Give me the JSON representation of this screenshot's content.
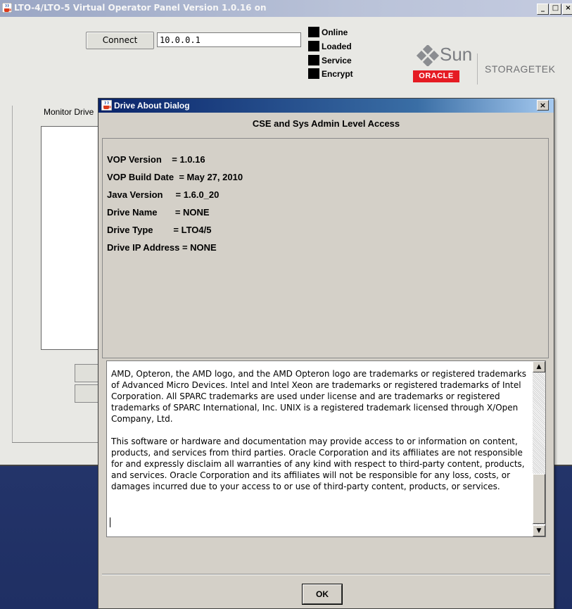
{
  "main_window": {
    "title": "LTO-4/LTO-5 Virtual Operator Panel Version 1.0.16 on",
    "controls": {
      "minimize": "_",
      "maximize": "□",
      "close": "×"
    },
    "connect_label": "Connect",
    "ip_value": "10.0.0.1",
    "status": [
      "Online",
      "Loaded",
      "Service",
      "Encrypt"
    ],
    "monitor_label": "Monitor Drive",
    "logo": {
      "sun": "Sun",
      "oracle": "ORACLE",
      "storagetek": "STORAGETEK"
    }
  },
  "dialog": {
    "title": "Drive About Dialog",
    "close": "×",
    "header": "CSE and Sys Admin Level Access",
    "info": {
      "vop_version": "VOP Version    = 1.0.16",
      "vop_build_date": "VOP Build Date  = May 27, 2010",
      "java_version": "Java Version     = 1.6.0_20",
      "drive_name": "Drive Name       = NONE",
      "drive_type": "Drive Type        = LTO4/5",
      "drive_ip": "Drive IP Address = NONE"
    },
    "legal": {
      "para1": "AMD, Opteron, the AMD logo, and the AMD Opteron logo are trademarks or registered trademarks of Advanced Micro Devices. Intel and Intel Xeon are trademarks or registered trademarks of Intel Corporation. All SPARC trademarks are used under license and are trademarks or registered trademarks of SPARC International, Inc. UNIX is a registered trademark licensed through X/Open Company, Ltd.",
      "para2": "This software or hardware and documentation may provide access to or information on content, products, and services from third parties. Oracle Corporation and its affiliates are not responsible for and expressly disclaim all warranties of any kind with respect to third-party content, products, and services. Oracle Corporation and its affiliates will not be responsible for any loss, costs, or damages incurred due to your access to or use of third-party content, products, or services."
    },
    "scroll_up": "▲",
    "scroll_down": "▼",
    "ok_label": "OK"
  },
  "colors": {
    "dialog_title_start": "#0a246a",
    "dialog_title_end": "#a6caf0",
    "oracle_red": "#e51b23",
    "desktop": "#2a3c74"
  },
  "icons": [
    "java-cup-icon",
    "sun-diamond-icon"
  ]
}
